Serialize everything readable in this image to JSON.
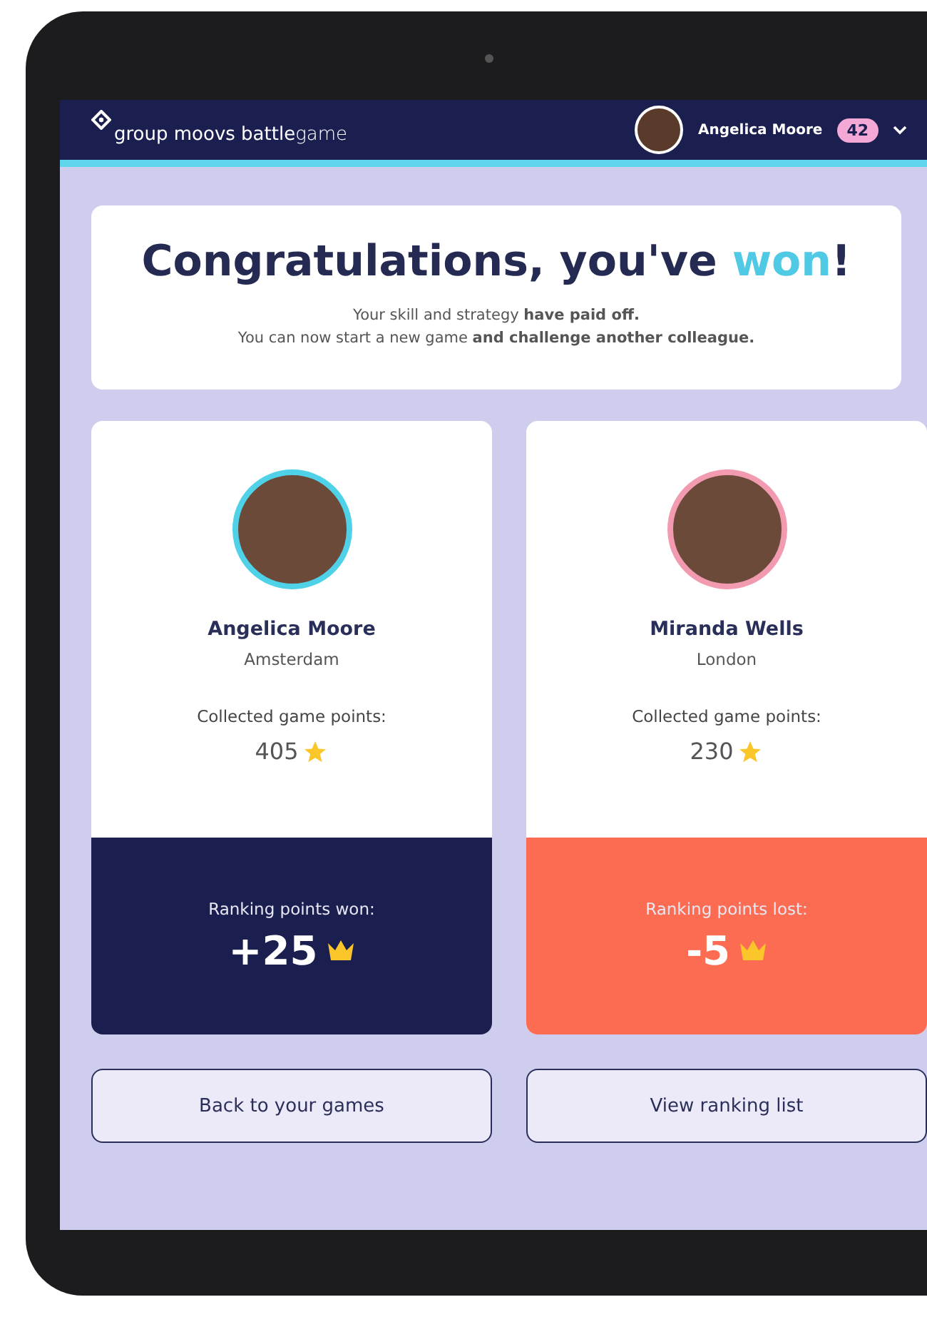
{
  "header": {
    "logo": "**group moovs battle**game",
    "user": {
      "name": "Angelica Moore",
      "badge": "42"
    }
  },
  "banner": {
    "title": [
      {
        "text": "Congratulations, you've ",
        "kind": "plain"
      },
      {
        "text": "won",
        "kind": "accent"
      },
      {
        "text": "!",
        "kind": "plain"
      }
    ],
    "lines": [
      "Your skill and strategy **have paid off.**",
      "You can now start a new game **and challenge another colleague.**"
    ]
  },
  "players": [
    {
      "name": "Angelica Moore",
      "city": "Amsterdam",
      "points_label": "Collected game points:",
      "points": "405",
      "result_label": "Ranking points won:",
      "result": "+25",
      "kind": "winner",
      "color": "#4fd1e8"
    },
    {
      "name": "Miranda Wells",
      "city": "London",
      "points_label": "Collected game points:",
      "points": "230",
      "result_label": "Ranking points lost:",
      "result": "-5",
      "kind": "loser",
      "color": "#f29bb0"
    }
  ],
  "buttons": [
    "Back to your games",
    "View ranking list"
  ]
}
